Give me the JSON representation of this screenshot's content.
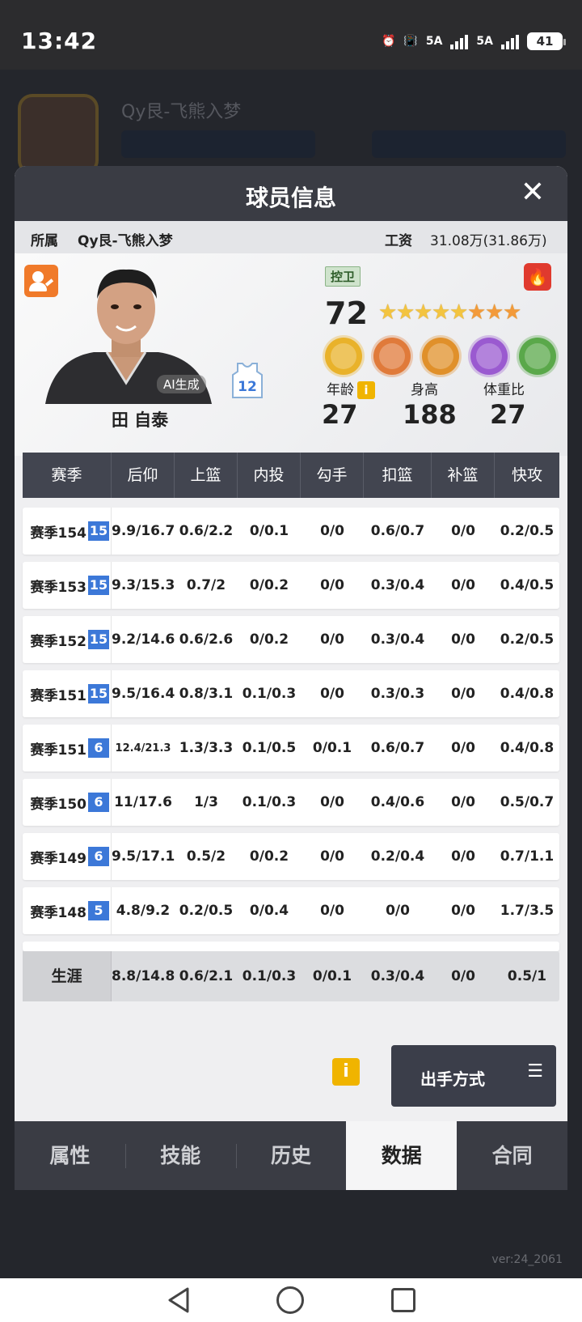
{
  "status": {
    "time": "13:42",
    "battery": "41",
    "net1": "5A",
    "net2": "5A"
  },
  "background": {
    "team_name": "Qy艮-飞熊入梦",
    "version": "ver:24_2061",
    "nav": [
      "",
      "",
      "",
      "",
      ""
    ]
  },
  "modal": {
    "title": "球员信息",
    "belong_label": "所属",
    "belong_value": "Qy艮-飞熊入梦",
    "salary_label": "工资",
    "salary_value": "31.08万(31.86万)"
  },
  "player": {
    "name": "田 自泰",
    "ai_tag": "AI生成",
    "jersey": "12",
    "position": "控卫",
    "rating": "72",
    "stars_gold": 5,
    "stars_orange": 3,
    "skill_colors": [
      "#e9b22a",
      "#e07a3a",
      "#e0902a",
      "#9a5ad0",
      "#5aa84a"
    ],
    "age_label": "年龄",
    "height_label": "身高",
    "weight_label": "体重比",
    "age": "27",
    "height": "188",
    "weight": "27"
  },
  "table": {
    "headers": [
      "赛季",
      "后仰",
      "上篮",
      "内投",
      "勾手",
      "扣篮",
      "补篮",
      "快攻"
    ],
    "rows": [
      {
        "season": "赛季154",
        "level": "15",
        "c": [
          "9.9/16.7",
          "0.6/2.2",
          "0/0.1",
          "0/0",
          "0.6/0.7",
          "0/0",
          "0.2/0.5"
        ]
      },
      {
        "season": "赛季153",
        "level": "15",
        "c": [
          "9.3/15.3",
          "0.7/2",
          "0/0.2",
          "0/0",
          "0.3/0.4",
          "0/0",
          "0.4/0.5"
        ]
      },
      {
        "season": "赛季152",
        "level": "15",
        "c": [
          "9.2/14.6",
          "0.6/2.6",
          "0/0.2",
          "0/0",
          "0.3/0.4",
          "0/0",
          "0.2/0.5"
        ]
      },
      {
        "season": "赛季151",
        "level": "15",
        "c": [
          "9.5/16.4",
          "0.8/3.1",
          "0.1/0.3",
          "0/0",
          "0.3/0.3",
          "0/0",
          "0.4/0.8"
        ]
      },
      {
        "season": "赛季151",
        "level": "6",
        "c": [
          "12.4/21.3",
          "1.3/3.3",
          "0.1/0.5",
          "0/0.1",
          "0.6/0.7",
          "0/0",
          "0.4/0.8"
        ]
      },
      {
        "season": "赛季150",
        "level": "6",
        "c": [
          "11/17.6",
          "1/3",
          "0.1/0.3",
          "0/0",
          "0.4/0.6",
          "0/0",
          "0.5/0.7"
        ]
      },
      {
        "season": "赛季149",
        "level": "6",
        "c": [
          "9.5/17.1",
          "0.5/2",
          "0/0.2",
          "0/0",
          "0.2/0.4",
          "0/0",
          "0.7/1.1"
        ]
      },
      {
        "season": "赛季148",
        "level": "5",
        "c": [
          "4.8/9.2",
          "0.2/0.5",
          "0/0.4",
          "0/0",
          "0/0",
          "0/0",
          "1.7/3.5"
        ]
      }
    ],
    "career_label": "生涯",
    "career": [
      "8.8/14.8",
      "0.6/2.1",
      "0.1/0.3",
      "0/0.1",
      "0.3/0.4",
      "0/0",
      "0.5/1"
    ]
  },
  "footer": {
    "info": "i",
    "shoot_button": "出手方式",
    "menu_glyph": "☰"
  },
  "tabs": [
    {
      "label": "属性",
      "active": false
    },
    {
      "label": "技能",
      "active": false
    },
    {
      "label": "历史",
      "active": false
    },
    {
      "label": "数据",
      "active": true
    },
    {
      "label": "合同",
      "active": false
    }
  ]
}
